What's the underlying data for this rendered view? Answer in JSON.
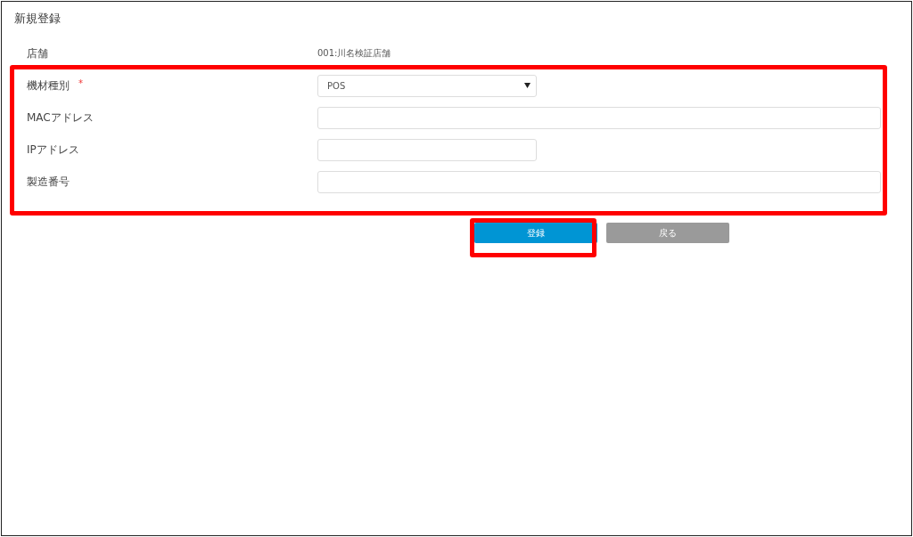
{
  "title": "新規登録",
  "store": {
    "label": "店舗",
    "value": "001:川名検証店舗"
  },
  "fields": [
    {
      "label": "機材種別",
      "required_mark": "*",
      "kind": "select",
      "value": "POS"
    },
    {
      "label": "MACアドレス",
      "kind": "wide"
    },
    {
      "label": "IPアドレス",
      "kind": "short"
    },
    {
      "label": "製造番号",
      "kind": "wide"
    }
  ],
  "buttons": [
    {
      "label": "登録",
      "kind": "primary"
    },
    {
      "label": "戻る",
      "kind": "secondary"
    }
  ]
}
